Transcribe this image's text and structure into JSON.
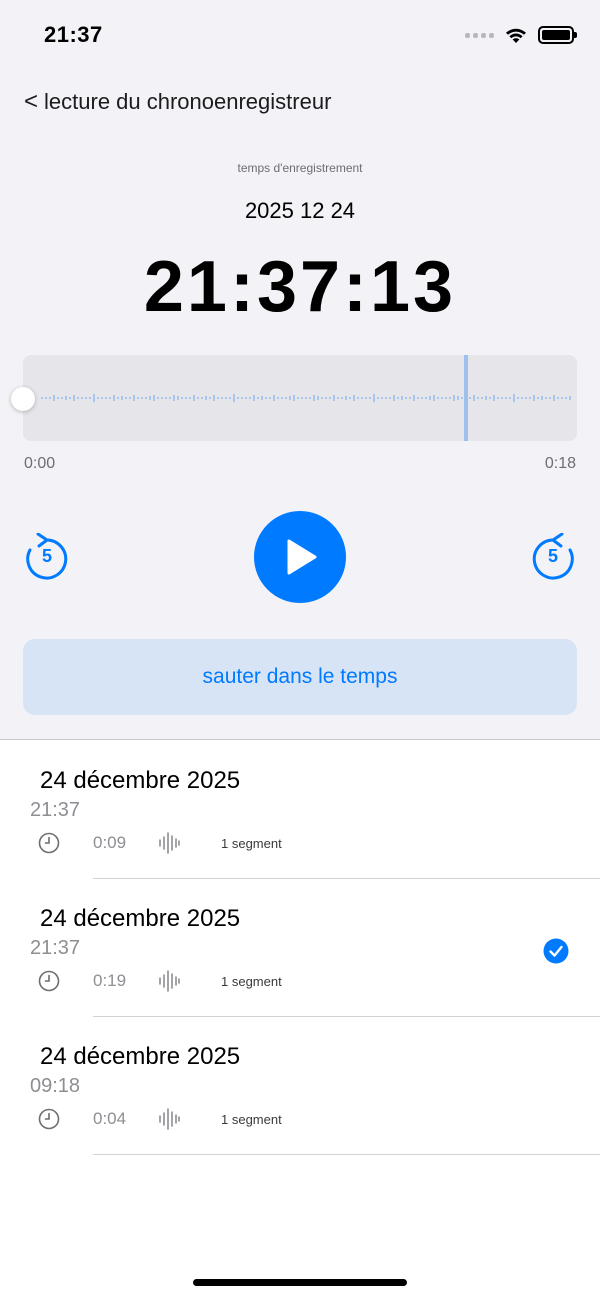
{
  "status_bar": {
    "time": "21:37"
  },
  "nav": {
    "back_chevron": "<",
    "back_label": "lecture du chronoenregistreur"
  },
  "recording": {
    "label": "temps d'enregistrement",
    "date": "2025 12 24",
    "time": "21:37:13"
  },
  "player": {
    "start_time": "0:00",
    "end_time": "0:18",
    "skip_back_seconds": "5",
    "skip_forward_seconds": "5",
    "playhead_progress": 0.0
  },
  "jump_button_label": "sauter dans le temps",
  "recordings": [
    {
      "title": "24 décembre 2025",
      "time": "21:37",
      "duration": "0:09",
      "segments": "1 segment",
      "selected": false
    },
    {
      "title": "24 décembre 2025",
      "time": "21:37",
      "duration": "0:19",
      "segments": "1 segment",
      "selected": true
    },
    {
      "title": "24 décembre 2025",
      "time": "09:18",
      "duration": "0:04",
      "segments": "1 segment",
      "selected": false
    }
  ],
  "icons": {
    "back": "chevron-left-icon",
    "skip_back": "rotate-back-5-icon",
    "skip_forward": "rotate-forward-5-icon",
    "play": "play-icon",
    "clock": "clock-icon",
    "waveform": "waveform-icon",
    "check": "checkmark-circle-icon"
  },
  "colors": {
    "accent": "#007aff",
    "background": "#f2f2f7",
    "jump_button": "#d7e4f6",
    "waveform_bar": "#a9c6ee"
  }
}
